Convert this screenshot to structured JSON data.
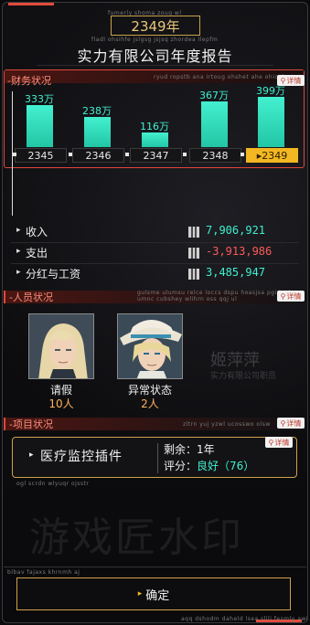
{
  "header": {
    "small_text": "fumerly shoma zoug wl",
    "year": "2349年",
    "sub_small": "fladl ohsihfe jslgsg jsjsq zhordea llepfm",
    "title": "实力有限公司年度报告"
  },
  "finance": {
    "label": "-财务状况",
    "detail_label": "详情",
    "small_text": "ryud ropstb ana irtoug ohshet ahe ohicek",
    "chart_data": {
      "type": "bar",
      "categories": [
        "2345",
        "2346",
        "2347",
        "2348",
        "2349"
      ],
      "values": [
        333,
        238,
        116,
        367,
        399
      ],
      "value_labels": [
        "333万",
        "238万",
        "116万",
        "367万",
        "399万"
      ],
      "selected": "2349"
    },
    "stats": [
      {
        "name": "收入",
        "value": "7,906,921",
        "color": "#3ff0cf"
      },
      {
        "name": "支出",
        "value": "-3,913,986",
        "color": "#ff5a5a"
      },
      {
        "name": "分红与工资",
        "value": "3,485,947",
        "color": "#3ff0cf"
      }
    ]
  },
  "people": {
    "label": "-人员状况",
    "detail_label": "详情",
    "small_text": "gulsme ulumsu relce loccs dspu hoasjsa pgi hsdsgcn",
    "small_text2": "umnc cubshey wlihrn oss qqj ul",
    "items": [
      {
        "name": "请假",
        "count": "10人"
      },
      {
        "name": "异常状态",
        "count": "2人"
      }
    ],
    "bg_name": "姬萍萍",
    "bg_sub": "实力有限公司职员"
  },
  "project": {
    "label": "-项目状况",
    "detail_label": "详情",
    "small_text": "zltrn yuj yzwl ucosswo olsw",
    "name": "医疗监控插件",
    "remaining_label": "剩余：",
    "remaining_value": "1年",
    "score_label": "评分：",
    "score_value": "良好（76）",
    "small_under": "ogl scrdn wlyuqr ojsstr"
  },
  "watermark": "游戏匠水印",
  "footer": {
    "small_left": "blbav fajaxs khrnmh aj",
    "small_right": "aqq dshodm daheld lsea slili fesmly awi",
    "confirm_label": "确定"
  },
  "colors": {
    "accent_red": "#e1473b",
    "accent_gold": "#cda24a",
    "bar": "#3ff0cf",
    "selected_tab": "#f2b722"
  }
}
